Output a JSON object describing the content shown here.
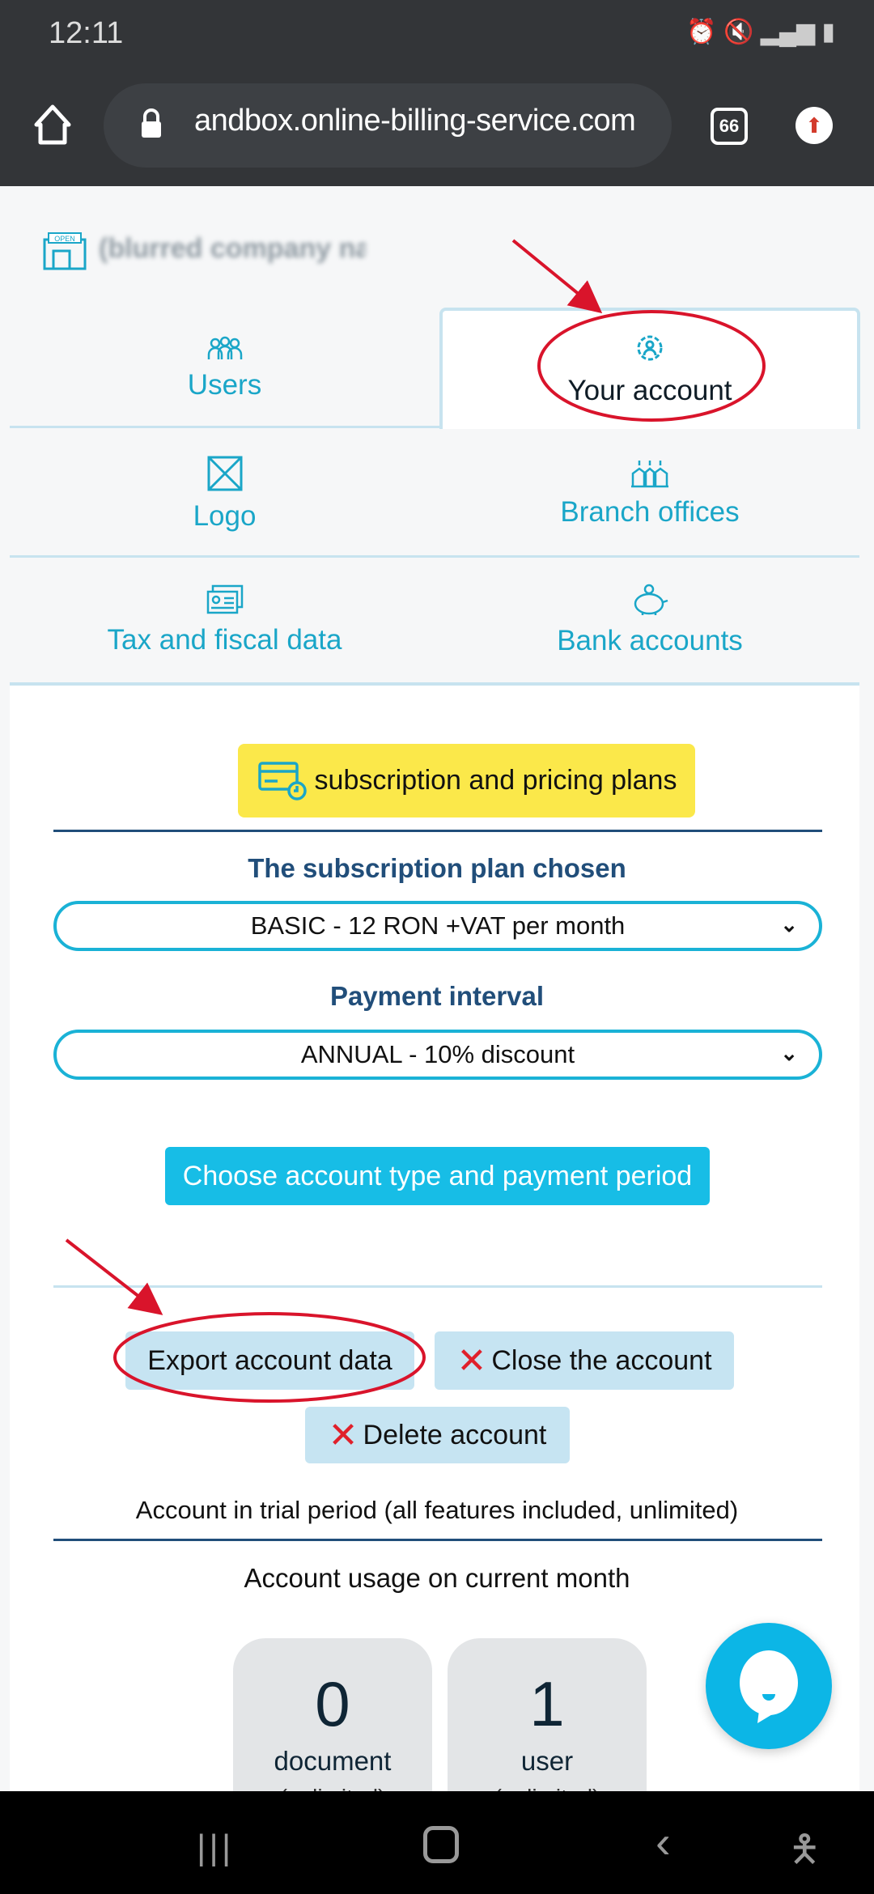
{
  "status_bar": {
    "time": "12:11"
  },
  "browser": {
    "url": "andbox.online-billing-service.com",
    "tab_count": "66"
  },
  "company": {
    "name": "(blurred company name)"
  },
  "tabs": [
    {
      "label": "Users",
      "icon": "users-icon"
    },
    {
      "label": "Your account",
      "icon": "gear-user-icon",
      "active": true
    },
    {
      "label": "Logo",
      "icon": "logo-icon"
    },
    {
      "label": "Branch offices",
      "icon": "branch-icon"
    },
    {
      "label": "Tax and fiscal data",
      "icon": "id-card-icon"
    },
    {
      "label": "Bank accounts",
      "icon": "piggy-bank-icon"
    }
  ],
  "subscription": {
    "plans_button": "subscription and pricing plans",
    "plan_title": "The subscription plan chosen",
    "plan_value": "BASIC - 12 RON +VAT per month",
    "interval_title": "Payment interval",
    "interval_value": "ANNUAL - 10% discount",
    "choose_button": "Choose account type and payment period"
  },
  "account_actions": {
    "export": "Export account data",
    "close": "Close the account",
    "delete": "Delete account",
    "trial_text": "Account in trial period (all features included, unlimited)"
  },
  "usage": {
    "title": "Account usage on current month",
    "cards": [
      {
        "value": "0",
        "label": "document",
        "sub": "(unlimited)"
      },
      {
        "value": "1",
        "label": "user",
        "sub": "(unlimited)"
      }
    ]
  },
  "colors": {
    "accent": "#1ab2d6",
    "highlight": "#fbe84a",
    "annotation": "#d9142b"
  }
}
